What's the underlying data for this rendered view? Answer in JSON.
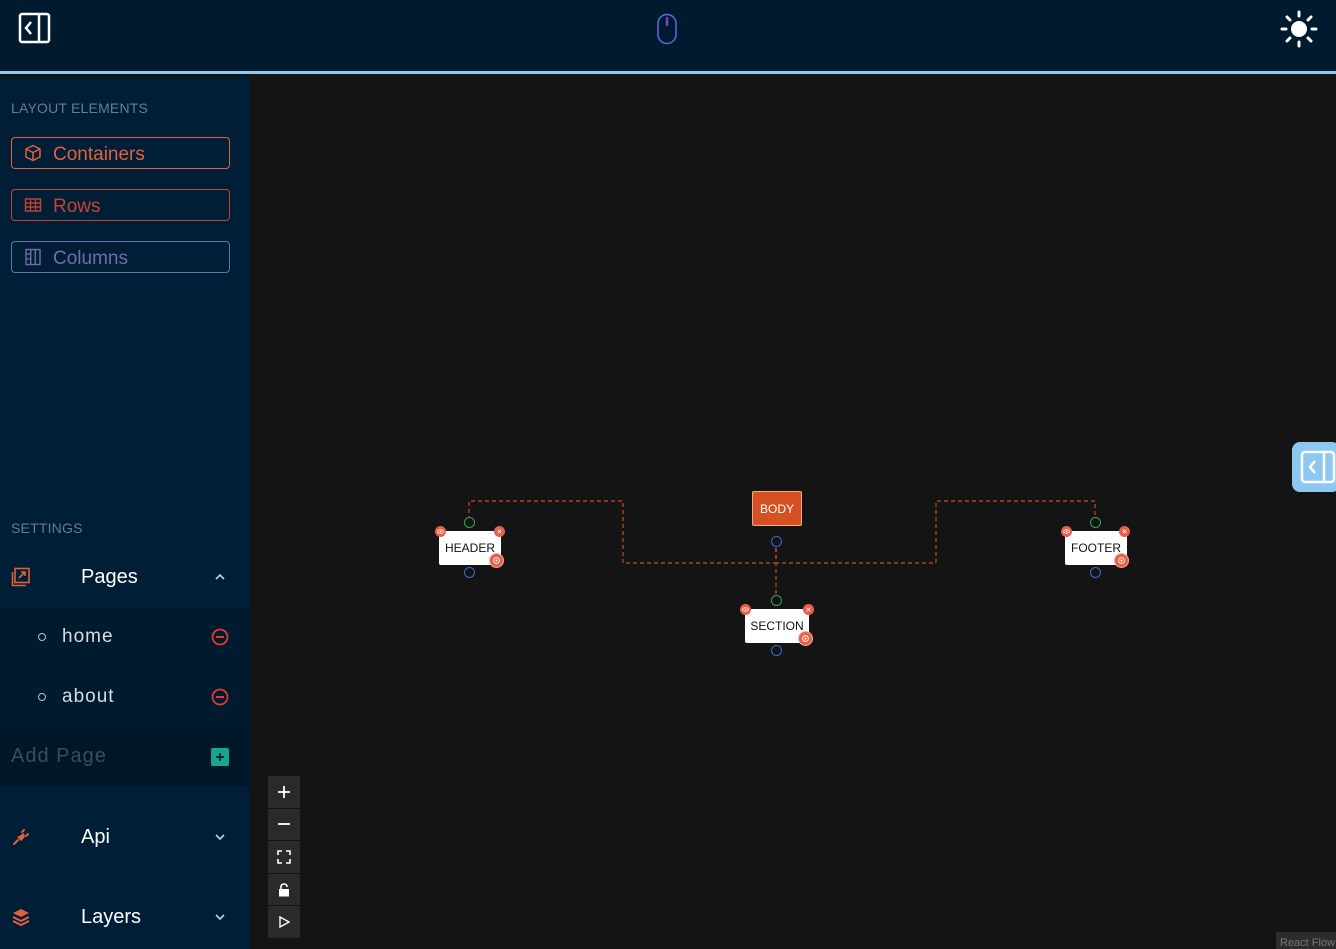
{
  "topbar": {
    "left_toggle_icon": "sidebar-collapse-icon",
    "center_icon": "mouse-icon",
    "theme_icon": "sun-icon"
  },
  "sidebar": {
    "layout_title": "LAYOUT ELEMENTS",
    "layout_items": [
      {
        "label": "Containers",
        "icon": "cube-icon",
        "color": "#e0613d"
      },
      {
        "label": "Rows",
        "icon": "rows-icon",
        "color": "#c44334"
      },
      {
        "label": "Columns",
        "icon": "columns-icon",
        "color": "#6e6ea8"
      }
    ],
    "settings_title": "SETTINGS",
    "pages": {
      "label": "Pages",
      "expanded": true,
      "items": [
        {
          "name": "home"
        },
        {
          "name": "about"
        }
      ],
      "add_placeholder": "Add Page"
    },
    "api": {
      "label": "Api",
      "expanded": false
    },
    "layers": {
      "label": "Layers",
      "expanded": false
    }
  },
  "canvas": {
    "nodes": [
      {
        "id": "body",
        "label": "BODY"
      },
      {
        "id": "header",
        "label": "HEADER"
      },
      {
        "id": "section",
        "label": "SECTION"
      },
      {
        "id": "footer",
        "label": "FOOTER"
      }
    ],
    "edges": [
      {
        "source": "body",
        "target": "header"
      },
      {
        "source": "body",
        "target": "section"
      },
      {
        "source": "body",
        "target": "footer"
      }
    ],
    "edge_color": "#d65121",
    "controls": [
      "zoom-in",
      "zoom-out",
      "fit-view",
      "lock",
      "play"
    ],
    "attribution": "React Flow"
  },
  "colors": {
    "topbar_bg": "#001a2f",
    "sidebar_bg": "#001e36",
    "canvas_bg": "#141414",
    "accent_blue": "#90c8ee",
    "node_badge": "#e8604a",
    "body_node": "#d65121"
  }
}
